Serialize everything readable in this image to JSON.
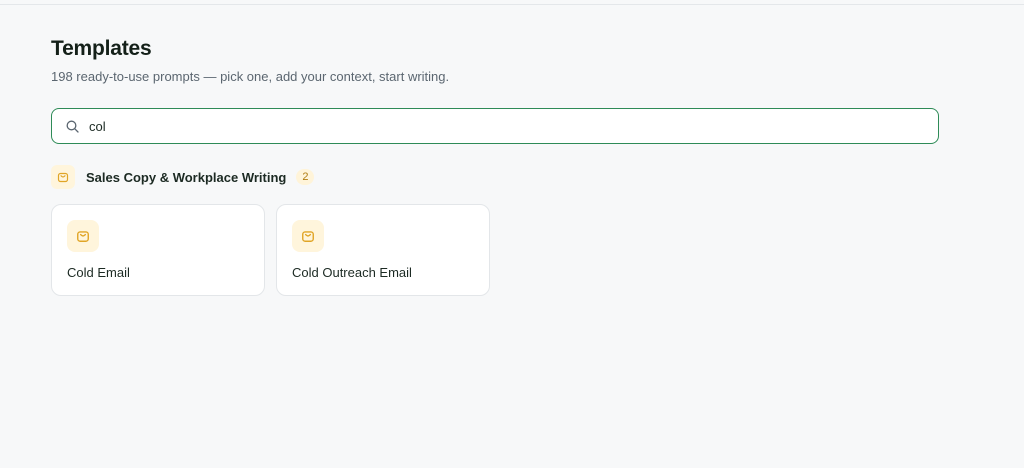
{
  "page": {
    "title": "Templates",
    "subtitle": "198 ready-to-use prompts — pick one, add your context, start writing."
  },
  "search": {
    "value": "col",
    "icon": "search-icon"
  },
  "category": {
    "label": "Sales Copy & Workplace Writing",
    "count": "2",
    "icon": "shopping-bag-icon"
  },
  "cards": [
    {
      "title": "Cold Email",
      "icon": "shopping-bag-icon"
    },
    {
      "title": "Cold Outreach Email",
      "icon": "shopping-bag-icon"
    }
  ],
  "colors": {
    "accent": "#2e8b57",
    "icon_bg": "#fff5dc",
    "icon_stroke": "#e0a526",
    "background": "#f7f8f9"
  }
}
